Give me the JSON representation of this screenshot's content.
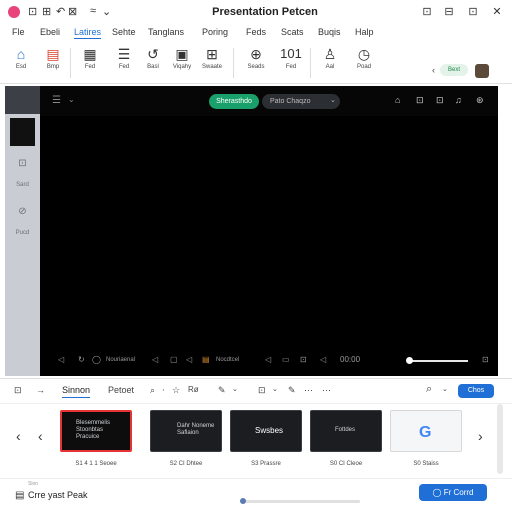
{
  "titlebar": {
    "title": "Presentation Petcen",
    "quick_access": [
      "⊡",
      "⊞",
      "↶",
      "⊠",
      "≈",
      "⌄"
    ],
    "win_controls": [
      "⊡",
      "⊟",
      "⊡",
      "✕"
    ]
  },
  "menu": {
    "items": [
      "Fle",
      "Ebeli",
      "Latires",
      "Sehte",
      "Tanglans",
      "Poring",
      "Feds",
      "Scats",
      "Buqis",
      "Halp"
    ],
    "active_index": 2
  },
  "ribbon": {
    "buttons": [
      {
        "icon": "home-icon",
        "glyph": "⌂",
        "label": "Esd"
      },
      {
        "icon": "slide-icon",
        "glyph": "▤",
        "label": "Bmp"
      },
      {
        "icon": "table-icon",
        "glyph": "▦",
        "label": "Fed"
      },
      {
        "icon": "list-icon",
        "glyph": "☰",
        "label": "Fed"
      },
      {
        "icon": "swirl-icon",
        "glyph": "↺",
        "label": "Basl"
      },
      {
        "icon": "picture-icon",
        "glyph": "▣",
        "label": "Viqahy"
      },
      {
        "icon": "shapes-icon",
        "glyph": "⊞",
        "label": "Swaate"
      },
      {
        "icon": "globe-icon",
        "glyph": "⊕",
        "label": "Seads"
      },
      {
        "icon": "number-icon",
        "glyph": "101",
        "label": "Fed"
      },
      {
        "icon": "person-icon",
        "glyph": "♙",
        "label": "Aal"
      },
      {
        "icon": "clock-icon",
        "glyph": "◷",
        "label": "Poad"
      }
    ],
    "share_label": "Bext",
    "chevron": "‹"
  },
  "rail": {
    "items": [
      {
        "icon": "layers-icon",
        "glyph": "⊡",
        "label": "Sard"
      },
      {
        "icon": "link-icon",
        "glyph": "⊘",
        "label": "Pucd"
      }
    ]
  },
  "stage": {
    "menu_glyph": "☰",
    "chevron": "⌄",
    "green_pill": "Sherasthdo",
    "dark_pill": "Pato   Chaqzo",
    "dark_pill_chevron": "⌄",
    "right_icons": [
      "⌂",
      "⊡",
      "⊡",
      "♫",
      "⊛"
    ],
    "controls": [
      "◁",
      "↻",
      "◯",
      "Nouriaenal",
      "◁",
      "▢",
      "◁",
      "▤",
      "Nocdtcel",
      "◁",
      "▭",
      "⊡",
      "◁",
      "00:00"
    ],
    "fullscreen": "⊡"
  },
  "editor_bar": {
    "left_icons": [
      "⊡",
      "→"
    ],
    "tabs": [
      "Sinnon",
      "Petoet"
    ],
    "tools": [
      "⌕",
      "⋅",
      "☆",
      "Rø",
      "✎",
      "⌄",
      "⊡",
      "⌄",
      "✎",
      "⋯",
      "⋯"
    ],
    "search_glyph": "⌕",
    "more": "⌄",
    "button": "Chos"
  },
  "filmstrip": {
    "prev": "‹",
    "prev2": "‹",
    "next": "›",
    "slides": [
      {
        "label": "S1 4 1 1 Seoee",
        "selected": true,
        "light": false,
        "text": [
          "Blesemmelis",
          "Stoonbtas",
          "Pracuice"
        ]
      },
      {
        "label": "S2 CI Dhtee",
        "selected": false,
        "light": false,
        "text": [
          "Dahr Noneme",
          "Saflaion"
        ]
      },
      {
        "label": "S3 Prassre",
        "selected": false,
        "light": false,
        "text": [
          "Swsbes"
        ]
      },
      {
        "label": "S0 CI Cleoe",
        "selected": false,
        "light": false,
        "text": [
          "Fottdes"
        ]
      },
      {
        "label": "S0 Staiss",
        "selected": false,
        "light": true,
        "text": [
          "G"
        ]
      }
    ]
  },
  "bottom": {
    "icon": "▤",
    "small": "Slon",
    "text": "Crre yast Peak",
    "button": "◯  Fr Corrd",
    "progress": 0.0
  }
}
